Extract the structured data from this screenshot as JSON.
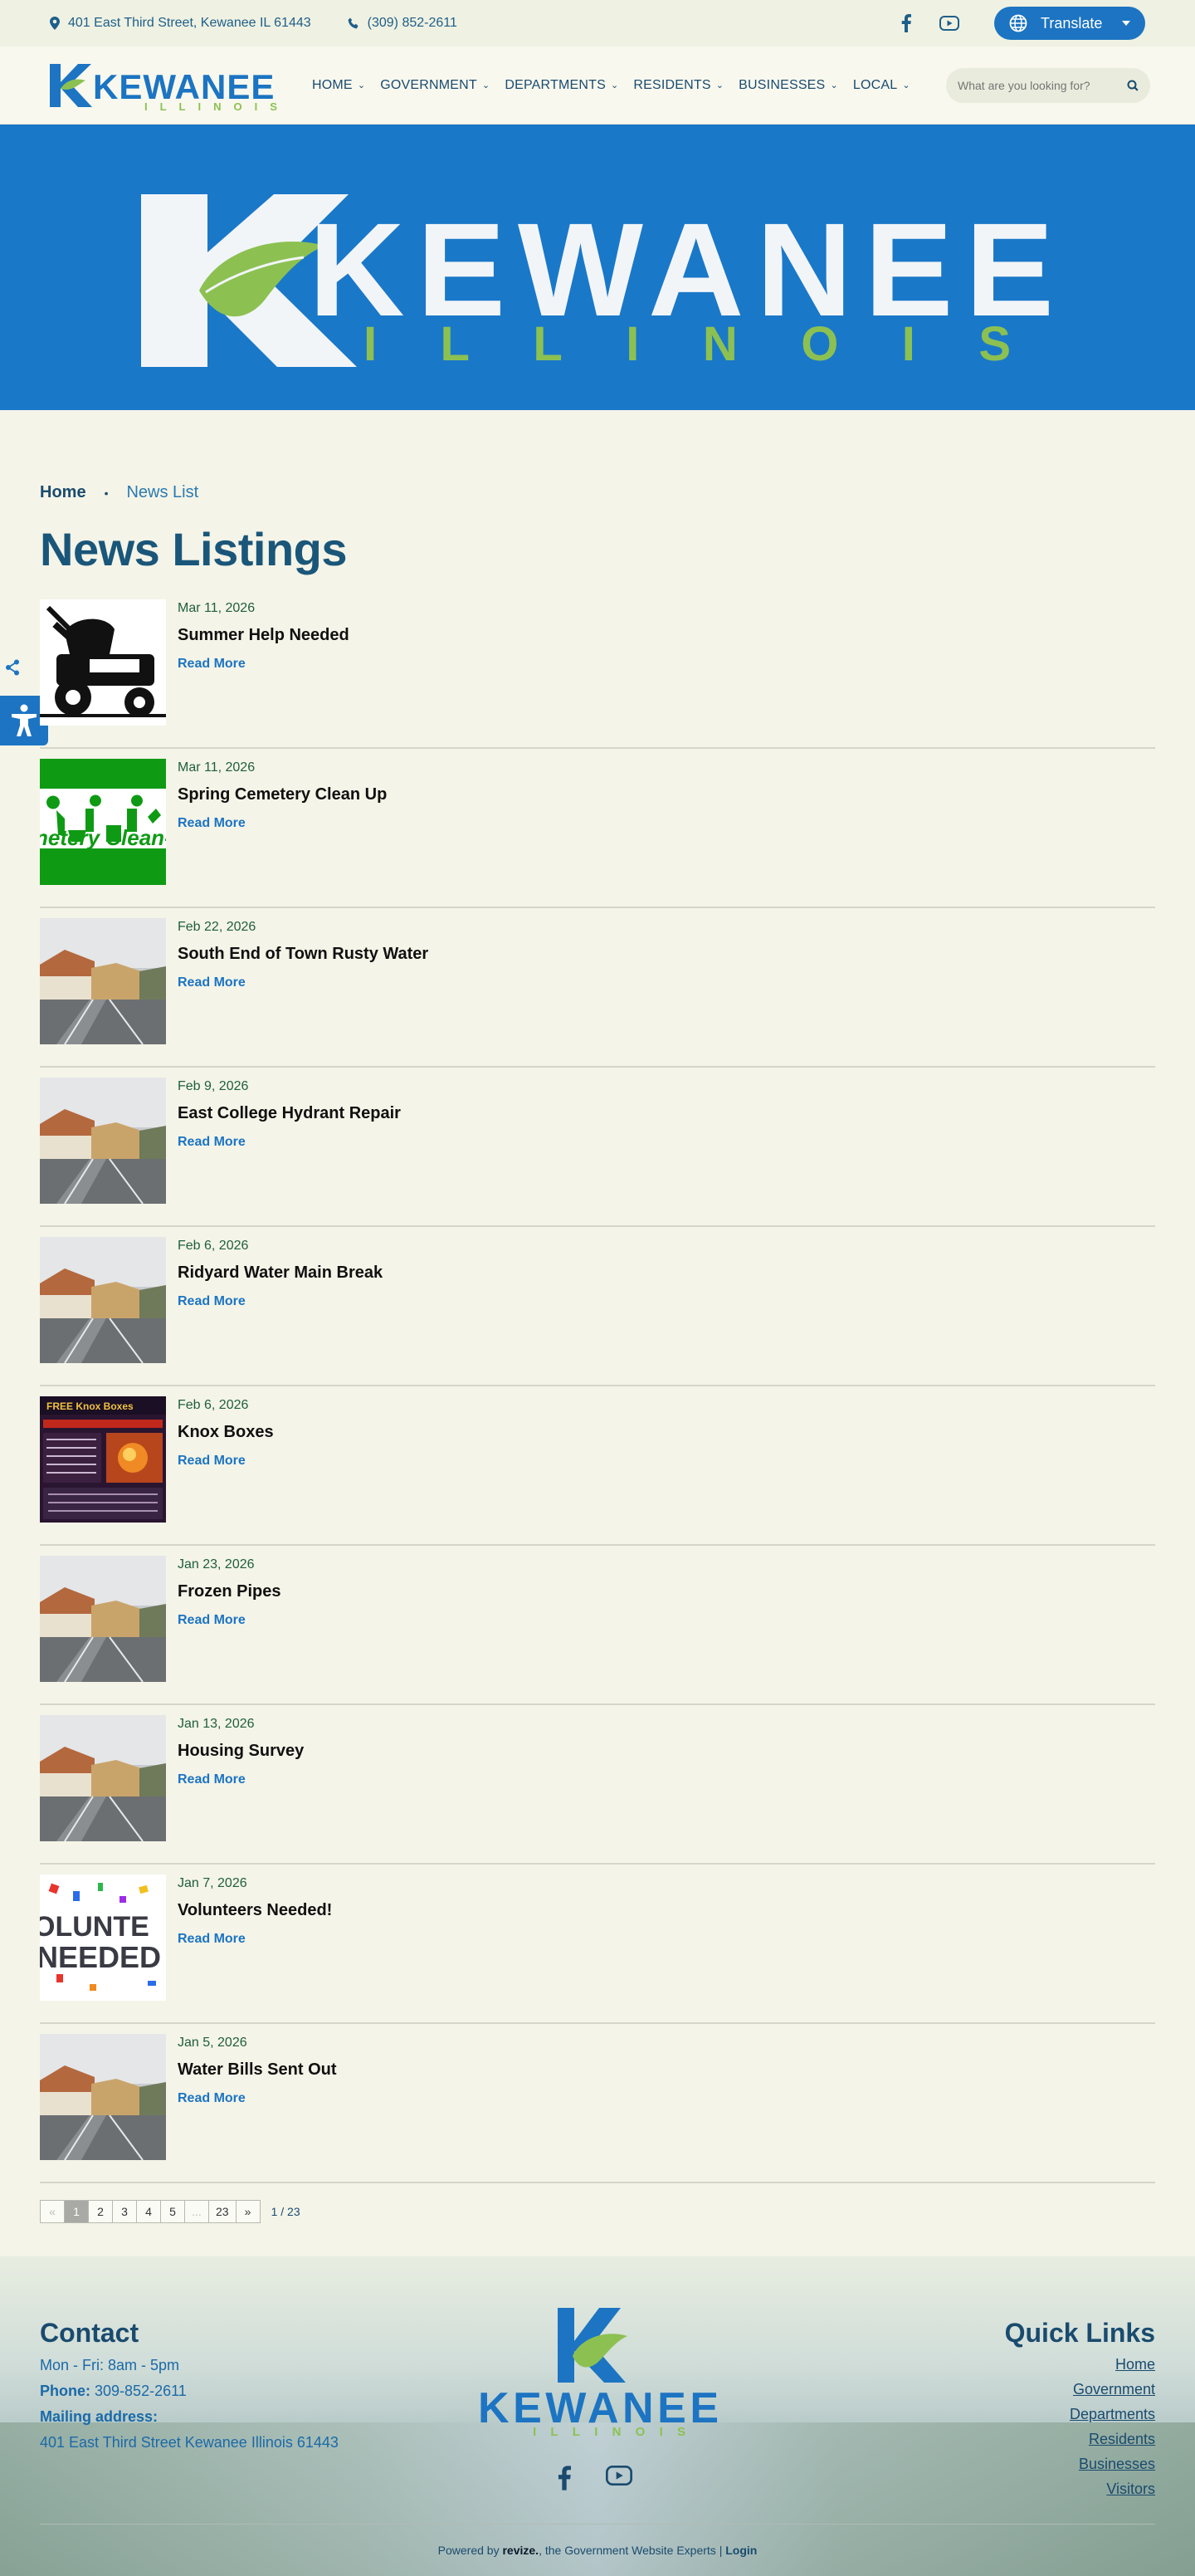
{
  "topbar": {
    "address": "401 East Third Street, Kewanee IL 61443",
    "phone": "(309) 852-2611",
    "translate_label": "Translate"
  },
  "logo": {
    "word": "KEWANEE",
    "sub": "ILLINOIS",
    "colors": {
      "blue": "#1c74c2",
      "green": "#8cc152",
      "white": "#f2f5f8"
    }
  },
  "nav": {
    "items": [
      "HOME",
      "GOVERNMENT",
      "DEPARTMENTS",
      "RESIDENTS",
      "BUSINESSES",
      "LOCAL"
    ]
  },
  "search": {
    "placeholder": "What are you looking for?"
  },
  "breadcrumb": {
    "home": "Home",
    "current": "News List"
  },
  "page_title": "News Listings",
  "news": [
    {
      "date": "Mar 11, 2026",
      "title": "Summer Help Needed",
      "more": "Read More",
      "thumb": "mower"
    },
    {
      "date": "Mar 11, 2026",
      "title": "Spring Cemetery Clean Up",
      "more": "Read More",
      "thumb": "cemetery",
      "thumb_text": "netery Clean-"
    },
    {
      "date": "Feb 22, 2026",
      "title": "South End of Town Rusty Water",
      "more": "Read More",
      "thumb": "street"
    },
    {
      "date": "Feb 9, 2026",
      "title": "East College Hydrant Repair",
      "more": "Read More",
      "thumb": "street"
    },
    {
      "date": "Feb 6, 2026",
      "title": "Ridyard Water Main Break",
      "more": "Read More",
      "thumb": "street"
    },
    {
      "date": "Feb 6, 2026",
      "title": "Knox Boxes",
      "more": "Read More",
      "thumb": "knox",
      "thumb_text": "FREE Knox Boxes"
    },
    {
      "date": "Jan 23, 2026",
      "title": "Frozen Pipes",
      "more": "Read More",
      "thumb": "street"
    },
    {
      "date": "Jan 13, 2026",
      "title": "Housing Survey",
      "more": "Read More",
      "thumb": "street"
    },
    {
      "date": "Jan 7, 2026",
      "title": "Volunteers Needed!",
      "more": "Read More",
      "thumb": "volunteers",
      "thumb_text_1": "OLUNTE",
      "thumb_text_2": "NEEDED"
    },
    {
      "date": "Jan 5, 2026",
      "title": "Water Bills Sent Out",
      "more": "Read More",
      "thumb": "street"
    }
  ],
  "pagination": {
    "prev": "«",
    "pages": [
      "1",
      "2",
      "3",
      "4",
      "5",
      "...",
      "23"
    ],
    "next": "»",
    "info": "1 / 23"
  },
  "footer": {
    "contact_heading": "Contact",
    "hours": "Mon - Fri: 8am - 5pm",
    "phone_label": "Phone:",
    "phone": "309-852-2611",
    "mailing_label": "Mailing address:",
    "mailing": "401 East Third Street Kewanee Illinois 61443",
    "quick_heading": "Quick Links",
    "quick_links": [
      "Home",
      "Government",
      "Departments",
      "Residents",
      "Businesses",
      "Visitors"
    ],
    "powered_prefix": "Powered by",
    "powered_brand": "revize.",
    "powered_suffix": ", the Government Website Experts |",
    "login": "Login"
  }
}
